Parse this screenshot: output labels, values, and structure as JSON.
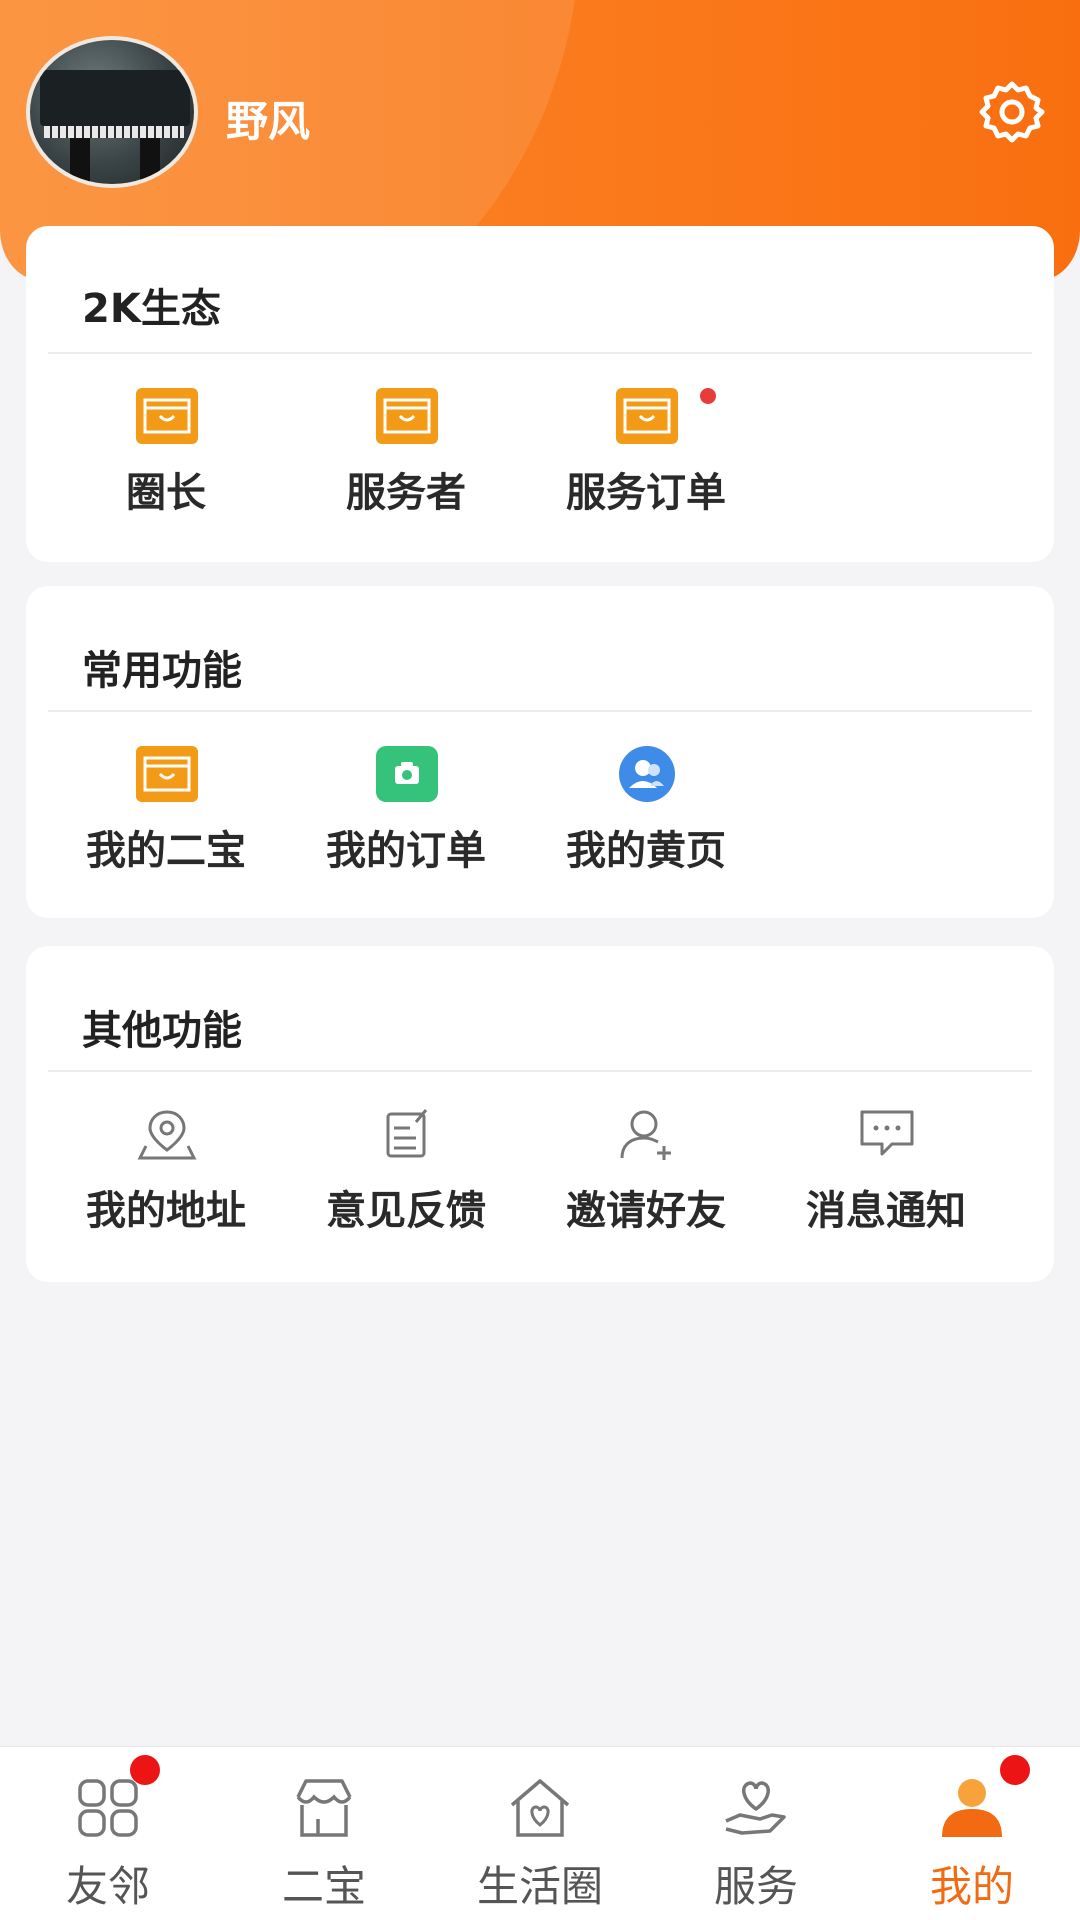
{
  "profile": {
    "name": "野风"
  },
  "eco": {
    "title": "2K生态",
    "items": [
      {
        "label": "圈长",
        "icon": "orange-box-icon"
      },
      {
        "label": "服务者",
        "icon": "orange-box-icon"
      },
      {
        "label": "服务订单",
        "icon": "orange-box-icon",
        "badge": true
      }
    ]
  },
  "common": {
    "title": "常用功能",
    "items": [
      {
        "label": "我的二宝",
        "icon": "orange-box-icon"
      },
      {
        "label": "我的订单",
        "icon": "green-camera-icon"
      },
      {
        "label": "我的黄页",
        "icon": "blue-contacts-icon"
      }
    ]
  },
  "other": {
    "title": "其他功能",
    "items": [
      {
        "label": "我的地址",
        "icon": "map-pin-icon"
      },
      {
        "label": "意见反馈",
        "icon": "feedback-edit-icon"
      },
      {
        "label": "邀请好友",
        "icon": "add-user-icon"
      },
      {
        "label": "消息通知",
        "icon": "message-icon"
      }
    ]
  },
  "nav": {
    "items": [
      {
        "label": "友邻",
        "icon": "grid-icon",
        "badge": true
      },
      {
        "label": "二宝",
        "icon": "store-icon"
      },
      {
        "label": "生活圈",
        "icon": "home-heart-icon"
      },
      {
        "label": "服务",
        "icon": "hand-heart-icon"
      },
      {
        "label": "我的",
        "icon": "person-icon",
        "badge": true,
        "active": true
      }
    ]
  },
  "colors": {
    "accent": "#f96f10",
    "icon_orange": "#f39a16",
    "icon_green": "#35c27a",
    "icon_blue": "#3f8be8",
    "badge_red": "#ec1414"
  }
}
